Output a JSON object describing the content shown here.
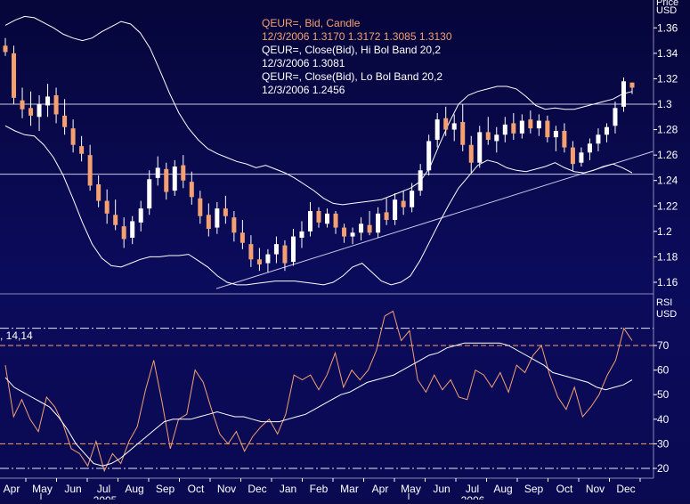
{
  "colors": {
    "background": "#0a0a52",
    "candle_up": "#ffffff",
    "candle_down": "#f4a070",
    "band": "#ffffff",
    "rsi_line": "#f4a070",
    "rsi_avg": "#ffffff",
    "ref_line": "#c8c8e8",
    "rsi_ref_line": "#ffa060",
    "text": "#ffffff",
    "legend_candle": "#f4a070"
  },
  "legend": {
    "line1": "QEUR=, Bid, Candle",
    "line2": "12/3/2006 1.3170 1.3172 1.3085 1.3130",
    "line3": "QEUR=, Close(Bid), Hi Bol Band 20,2",
    "line4": "12/3/2006 1.3081",
    "line5": "QEUR=, Close(Bid), Lo Bol Band 20,2",
    "line6": "12/3/2006 1.2456"
  },
  "price_axis": {
    "unit_top": "Price",
    "unit": "USD",
    "ticks": [
      "1.36",
      "1.34",
      "1.32",
      "1.3",
      "1.28",
      "1.26",
      "1.24",
      "1.22",
      "1.2",
      "1.18",
      "1.16"
    ]
  },
  "rsi_axis": {
    "label": "RSI",
    "unit": "USD",
    "ticks": [
      "70",
      "60",
      "50",
      "40",
      "30",
      "20"
    ],
    "series_label": ", 14,14"
  },
  "x_axis": {
    "months": [
      "Apr",
      "May",
      "Jun",
      "Jul",
      "Aug",
      "Sep",
      "Oct",
      "Nov",
      "Dec",
      "Jan",
      "Feb",
      "Mar",
      "Apr",
      "May",
      "Jun",
      "Jul",
      "Aug",
      "Sep",
      "Oct",
      "Nov",
      "Dec"
    ],
    "years": [
      "2005",
      "2006"
    ]
  },
  "chart_data": [
    {
      "type": "candlestick",
      "title": "QEUR=, Bid, Candle",
      "y_unit": "USD",
      "ylim": [
        1.16,
        1.37
      ],
      "x_range": [
        "2005-04",
        "2006-12"
      ],
      "reference_lines": [
        1.3,
        1.245
      ],
      "trend_line": {
        "from": [
          "2005-12",
          1.155
        ],
        "to": [
          "2006-12",
          1.263
        ]
      },
      "candles": [
        {
          "o": 1.346,
          "h": 1.352,
          "l": 1.338,
          "c": 1.341
        },
        {
          "o": 1.34,
          "h": 1.346,
          "l": 1.3,
          "c": 1.305
        },
        {
          "o": 1.303,
          "h": 1.313,
          "l": 1.289,
          "c": 1.296
        },
        {
          "o": 1.297,
          "h": 1.31,
          "l": 1.283,
          "c": 1.291
        },
        {
          "o": 1.29,
          "h": 1.307,
          "l": 1.279,
          "c": 1.3
        },
        {
          "o": 1.299,
          "h": 1.316,
          "l": 1.29,
          "c": 1.306
        },
        {
          "o": 1.307,
          "h": 1.313,
          "l": 1.285,
          "c": 1.292
        },
        {
          "o": 1.291,
          "h": 1.304,
          "l": 1.276,
          "c": 1.282
        },
        {
          "o": 1.281,
          "h": 1.288,
          "l": 1.262,
          "c": 1.268
        },
        {
          "o": 1.267,
          "h": 1.275,
          "l": 1.255,
          "c": 1.261
        },
        {
          "o": 1.26,
          "h": 1.268,
          "l": 1.232,
          "c": 1.236
        },
        {
          "o": 1.237,
          "h": 1.244,
          "l": 1.219,
          "c": 1.224
        },
        {
          "o": 1.224,
          "h": 1.233,
          "l": 1.206,
          "c": 1.214
        },
        {
          "o": 1.213,
          "h": 1.225,
          "l": 1.201,
          "c": 1.205
        },
        {
          "o": 1.204,
          "h": 1.211,
          "l": 1.187,
          "c": 1.194
        },
        {
          "o": 1.195,
          "h": 1.212,
          "l": 1.19,
          "c": 1.208
        },
        {
          "o": 1.207,
          "h": 1.224,
          "l": 1.2,
          "c": 1.218
        },
        {
          "o": 1.218,
          "h": 1.248,
          "l": 1.213,
          "c": 1.241
        },
        {
          "o": 1.242,
          "h": 1.259,
          "l": 1.236,
          "c": 1.25
        },
        {
          "o": 1.249,
          "h": 1.254,
          "l": 1.225,
          "c": 1.231
        },
        {
          "o": 1.232,
          "h": 1.256,
          "l": 1.228,
          "c": 1.251
        },
        {
          "o": 1.252,
          "h": 1.26,
          "l": 1.234,
          "c": 1.24
        },
        {
          "o": 1.239,
          "h": 1.247,
          "l": 1.221,
          "c": 1.227
        },
        {
          "o": 1.226,
          "h": 1.232,
          "l": 1.206,
          "c": 1.212
        },
        {
          "o": 1.213,
          "h": 1.222,
          "l": 1.196,
          "c": 1.202
        },
        {
          "o": 1.203,
          "h": 1.223,
          "l": 1.198,
          "c": 1.218
        },
        {
          "o": 1.218,
          "h": 1.228,
          "l": 1.206,
          "c": 1.212
        },
        {
          "o": 1.211,
          "h": 1.216,
          "l": 1.192,
          "c": 1.199
        },
        {
          "o": 1.199,
          "h": 1.209,
          "l": 1.186,
          "c": 1.191
        },
        {
          "o": 1.19,
          "h": 1.197,
          "l": 1.172,
          "c": 1.178
        },
        {
          "o": 1.178,
          "h": 1.187,
          "l": 1.169,
          "c": 1.174
        },
        {
          "o": 1.175,
          "h": 1.186,
          "l": 1.168,
          "c": 1.182
        },
        {
          "o": 1.182,
          "h": 1.196,
          "l": 1.175,
          "c": 1.19
        },
        {
          "o": 1.189,
          "h": 1.193,
          "l": 1.169,
          "c": 1.175
        },
        {
          "o": 1.176,
          "h": 1.202,
          "l": 1.173,
          "c": 1.196
        },
        {
          "o": 1.195,
          "h": 1.208,
          "l": 1.187,
          "c": 1.2
        },
        {
          "o": 1.2,
          "h": 1.223,
          "l": 1.196,
          "c": 1.216
        },
        {
          "o": 1.216,
          "h": 1.219,
          "l": 1.203,
          "c": 1.207
        },
        {
          "o": 1.206,
          "h": 1.218,
          "l": 1.203,
          "c": 1.214
        },
        {
          "o": 1.214,
          "h": 1.216,
          "l": 1.198,
          "c": 1.203
        },
        {
          "o": 1.203,
          "h": 1.206,
          "l": 1.191,
          "c": 1.196
        },
        {
          "o": 1.196,
          "h": 1.203,
          "l": 1.19,
          "c": 1.199
        },
        {
          "o": 1.199,
          "h": 1.211,
          "l": 1.193,
          "c": 1.206
        },
        {
          "o": 1.205,
          "h": 1.216,
          "l": 1.197,
          "c": 1.199
        },
        {
          "o": 1.199,
          "h": 1.219,
          "l": 1.195,
          "c": 1.214
        },
        {
          "o": 1.215,
          "h": 1.226,
          "l": 1.205,
          "c": 1.209
        },
        {
          "o": 1.209,
          "h": 1.23,
          "l": 1.205,
          "c": 1.225
        },
        {
          "o": 1.224,
          "h": 1.232,
          "l": 1.213,
          "c": 1.219
        },
        {
          "o": 1.219,
          "h": 1.238,
          "l": 1.215,
          "c": 1.232
        },
        {
          "o": 1.232,
          "h": 1.253,
          "l": 1.228,
          "c": 1.248
        },
        {
          "o": 1.248,
          "h": 1.276,
          "l": 1.244,
          "c": 1.271
        },
        {
          "o": 1.272,
          "h": 1.293,
          "l": 1.266,
          "c": 1.288
        },
        {
          "o": 1.289,
          "h": 1.298,
          "l": 1.275,
          "c": 1.28
        },
        {
          "o": 1.28,
          "h": 1.292,
          "l": 1.271,
          "c": 1.285
        },
        {
          "o": 1.286,
          "h": 1.3,
          "l": 1.263,
          "c": 1.268
        },
        {
          "o": 1.268,
          "h": 1.275,
          "l": 1.246,
          "c": 1.254
        },
        {
          "o": 1.254,
          "h": 1.283,
          "l": 1.25,
          "c": 1.278
        },
        {
          "o": 1.278,
          "h": 1.29,
          "l": 1.268,
          "c": 1.272
        },
        {
          "o": 1.271,
          "h": 1.282,
          "l": 1.262,
          "c": 1.276
        },
        {
          "o": 1.276,
          "h": 1.29,
          "l": 1.27,
          "c": 1.284
        },
        {
          "o": 1.285,
          "h": 1.293,
          "l": 1.272,
          "c": 1.277
        },
        {
          "o": 1.277,
          "h": 1.292,
          "l": 1.273,
          "c": 1.287
        },
        {
          "o": 1.288,
          "h": 1.295,
          "l": 1.277,
          "c": 1.281
        },
        {
          "o": 1.281,
          "h": 1.292,
          "l": 1.275,
          "c": 1.287
        },
        {
          "o": 1.287,
          "h": 1.291,
          "l": 1.27,
          "c": 1.274
        },
        {
          "o": 1.274,
          "h": 1.283,
          "l": 1.263,
          "c": 1.279
        },
        {
          "o": 1.279,
          "h": 1.285,
          "l": 1.262,
          "c": 1.266
        },
        {
          "o": 1.266,
          "h": 1.271,
          "l": 1.248,
          "c": 1.253
        },
        {
          "o": 1.254,
          "h": 1.266,
          "l": 1.251,
          "c": 1.262
        },
        {
          "o": 1.262,
          "h": 1.273,
          "l": 1.256,
          "c": 1.269
        },
        {
          "o": 1.269,
          "h": 1.281,
          "l": 1.263,
          "c": 1.276
        },
        {
          "o": 1.276,
          "h": 1.285,
          "l": 1.27,
          "c": 1.282
        },
        {
          "o": 1.283,
          "h": 1.302,
          "l": 1.277,
          "c": 1.297
        },
        {
          "o": 1.298,
          "h": 1.321,
          "l": 1.294,
          "c": 1.318
        },
        {
          "o": 1.317,
          "h": 1.317,
          "l": 1.308,
          "c": 1.313
        }
      ],
      "series": [
        {
          "name": "QEUR=, Close(Bid), Hi Bol Band 20,2",
          "value_label": "1.3081",
          "values": [
            1.362,
            1.366,
            1.369,
            1.368,
            1.364,
            1.36,
            1.355,
            1.352,
            1.35,
            1.352,
            1.357,
            1.361,
            1.365,
            1.363,
            1.356,
            1.344,
            1.327,
            1.309,
            1.293,
            1.281,
            1.272,
            1.265,
            1.261,
            1.258,
            1.255,
            1.253,
            1.25,
            1.252,
            1.249,
            1.246,
            1.242,
            1.237,
            1.232,
            1.226,
            1.222,
            1.221,
            1.222,
            1.223,
            1.224,
            1.225,
            1.228,
            1.231,
            1.234,
            1.239,
            1.25,
            1.268,
            1.285,
            1.3,
            1.307,
            1.31,
            1.312,
            1.314,
            1.314,
            1.312,
            1.306,
            1.299,
            1.296,
            1.297,
            1.296,
            1.296,
            1.298,
            1.3,
            1.302,
            1.304,
            1.308,
            1.31
          ]
        },
        {
          "name": "QEUR=, Close(Bid), Lo Bol Band 20,2",
          "value_label": "1.2456",
          "values": [
            1.283,
            1.279,
            1.276,
            1.275,
            1.268,
            1.258,
            1.244,
            1.226,
            1.207,
            1.19,
            1.179,
            1.173,
            1.172,
            1.175,
            1.178,
            1.18,
            1.18,
            1.181,
            1.181,
            1.182,
            1.177,
            1.172,
            1.165,
            1.16,
            1.158,
            1.158,
            1.159,
            1.16,
            1.161,
            1.161,
            1.161,
            1.16,
            1.159,
            1.158,
            1.16,
            1.165,
            1.172,
            1.175,
            1.168,
            1.161,
            1.158,
            1.16,
            1.165,
            1.177,
            1.192,
            1.207,
            1.221,
            1.234,
            1.243,
            1.252,
            1.256,
            1.254,
            1.25,
            1.248,
            1.247,
            1.249,
            1.251,
            1.254,
            1.25,
            1.247,
            1.246,
            1.248,
            1.251,
            1.253,
            1.25,
            1.246
          ]
        }
      ]
    },
    {
      "type": "line",
      "title": "RSI",
      "series_label": ", 14,14",
      "ylim": [
        17,
        80
      ],
      "reference_lines": [
        20,
        30,
        70,
        77
      ],
      "series": [
        {
          "name": "RSI",
          "values": [
            62,
            41,
            48,
            40,
            35,
            49,
            45,
            38,
            28,
            26,
            21,
            31,
            19,
            26,
            22,
            31,
            37,
            52,
            64,
            47,
            28,
            40,
            42,
            60,
            55,
            44,
            34,
            30,
            35,
            27,
            33,
            37,
            40,
            34,
            42,
            58,
            56,
            58,
            52,
            58,
            67,
            53,
            60,
            56,
            60,
            68,
            82,
            84,
            72,
            76,
            56,
            51,
            58,
            52,
            56,
            49,
            48,
            60,
            58,
            53,
            59,
            51,
            62,
            59,
            66,
            70,
            58,
            49,
            44,
            53,
            41,
            45,
            50,
            58,
            64,
            77,
            72
          ]
        },
        {
          "name": "Average",
          "values": [
            57,
            53,
            51,
            49,
            47,
            45,
            41,
            36,
            30,
            26,
            22,
            21,
            22,
            24,
            27,
            30,
            33,
            36,
            39,
            40,
            40,
            40,
            41,
            42,
            43,
            42,
            41,
            41,
            40,
            39,
            39,
            39,
            40,
            41,
            42,
            44,
            46,
            48,
            50,
            51,
            53,
            55,
            56,
            57,
            58,
            60,
            62,
            64,
            66,
            67,
            69,
            70,
            71,
            71,
            71,
            71,
            71,
            70,
            68,
            66,
            64,
            62,
            59,
            58,
            57,
            56,
            55,
            53,
            52,
            53,
            54,
            56
          ]
        }
      ]
    }
  ]
}
